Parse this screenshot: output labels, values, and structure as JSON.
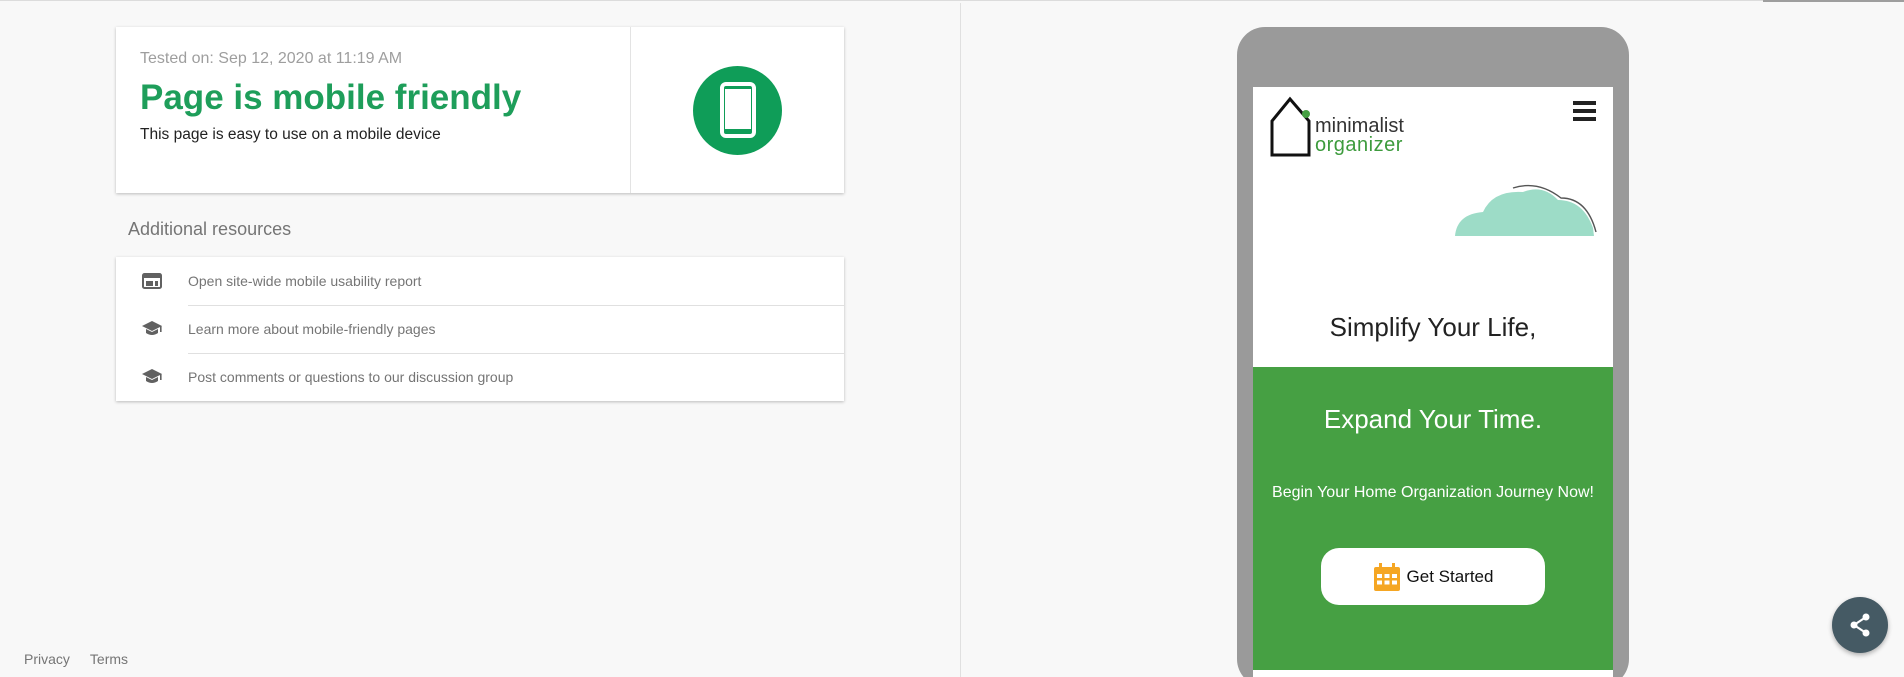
{
  "result": {
    "tested_on": "Tested on: Sep 12, 2020 at 11:19 AM",
    "title": "Page is mobile friendly",
    "subtitle": "This page is easy to use on a mobile device",
    "icon": "smartphone-icon"
  },
  "resources": {
    "heading": "Additional resources",
    "items": [
      {
        "label": "Open site-wide mobile usability report",
        "icon": "web-report-icon"
      },
      {
        "label": "Learn more about mobile-friendly pages",
        "icon": "school-icon"
      },
      {
        "label": "Post comments or questions to our discussion group",
        "icon": "school-icon"
      }
    ]
  },
  "footer": {
    "privacy": "Privacy",
    "terms": "Terms"
  },
  "preview": {
    "logo_line1": "minimalist",
    "logo_line2": "organizer",
    "headline1": "Simplify Your Life,",
    "headline2": "Expand Your Time.",
    "subheadline": "Begin Your Home Organization Journey Now!",
    "cta_label": "Get Started",
    "colors": {
      "brand_green": "#46a043",
      "cloud": "#9ddcc7",
      "cta_icon": "#f5a623"
    }
  },
  "colors": {
    "success": "#0f9d58",
    "fab": "#455a64"
  }
}
